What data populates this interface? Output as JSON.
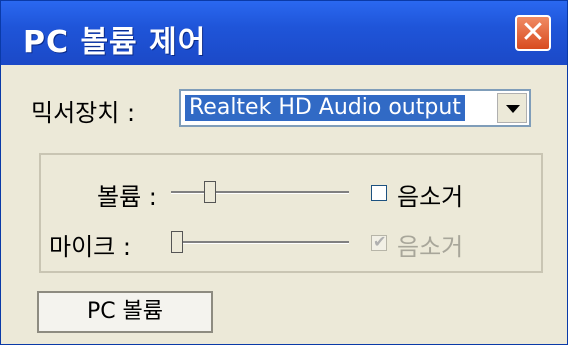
{
  "window": {
    "title": "PC 볼륨 제어",
    "close_glyph": "✕"
  },
  "mixer": {
    "label": "믹서장치 :",
    "selected": "Realtek HD Audio output"
  },
  "volume": {
    "label": "볼륨 :",
    "level": 0.2,
    "mute_label": "음소거",
    "mute_checked": false
  },
  "mic": {
    "label": "마이크 :",
    "level": 0.0,
    "mute_label": "음소거",
    "mute_checked": true,
    "disabled": true
  },
  "buttons": {
    "pc_volume": "PC 볼륨"
  },
  "colors": {
    "titlebar": "#1f55d9",
    "selection": "#316ac5"
  }
}
